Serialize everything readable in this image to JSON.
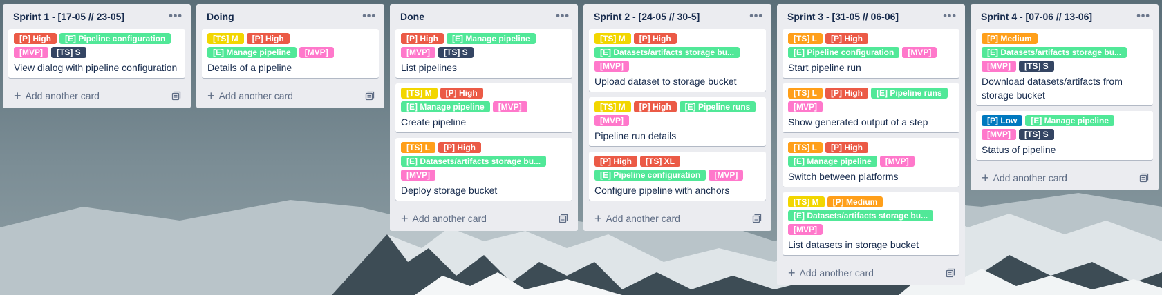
{
  "label_colors": {
    "green": "#61bd4f",
    "mint": "#51e898",
    "red": "#eb5a46",
    "orange": "#ff9f1a",
    "yellow": "#f2d600",
    "pink": "#ff78cb",
    "navy": "#344563",
    "blue": "#0079bf"
  },
  "add_card_label": "Add another card",
  "lists": [
    {
      "title": "Sprint 1 - [17-05 // 23-05]",
      "cards": [
        {
          "labels": [
            {
              "text": "[P] High",
              "color": "red"
            },
            {
              "text": "[E] Pipeline configuration",
              "color": "mint"
            },
            {
              "text": "[MVP]",
              "color": "pink"
            },
            {
              "text": "[TS] S",
              "color": "navy"
            }
          ],
          "title": "View dialog with pipeline configuration"
        }
      ]
    },
    {
      "title": "Doing",
      "cards": [
        {
          "labels": [
            {
              "text": "[TS] M",
              "color": "yellow"
            },
            {
              "text": "[P] High",
              "color": "red"
            },
            {
              "text": "[E] Manage pipeline",
              "color": "mint"
            },
            {
              "text": "[MVP]",
              "color": "pink"
            }
          ],
          "title": "Details of a pipeline"
        }
      ]
    },
    {
      "title": "Done",
      "cards": [
        {
          "labels": [
            {
              "text": "[P] High",
              "color": "red"
            },
            {
              "text": "[E] Manage pipeline",
              "color": "mint"
            },
            {
              "text": "[MVP]",
              "color": "pink"
            },
            {
              "text": "[TS] S",
              "color": "navy"
            }
          ],
          "title": "List pipelines"
        },
        {
          "labels": [
            {
              "text": "[TS] M",
              "color": "yellow"
            },
            {
              "text": "[P] High",
              "color": "red"
            },
            {
              "text": "[E] Manage pipeline",
              "color": "mint"
            },
            {
              "text": "[MVP]",
              "color": "pink"
            }
          ],
          "title": "Create pipeline"
        },
        {
          "labels": [
            {
              "text": "[TS] L",
              "color": "orange"
            },
            {
              "text": "[P] High",
              "color": "red"
            },
            {
              "text": "[E] Datasets/artifacts storage bu...",
              "color": "mint"
            },
            {
              "text": "[MVP]",
              "color": "pink"
            }
          ],
          "title": "Deploy storage bucket"
        }
      ]
    },
    {
      "title": "Sprint 2 - [24-05 // 30-5]",
      "cards": [
        {
          "labels": [
            {
              "text": "[TS] M",
              "color": "yellow"
            },
            {
              "text": "[P] High",
              "color": "red"
            },
            {
              "text": "[E] Datasets/artifacts storage bu...",
              "color": "mint"
            },
            {
              "text": "[MVP]",
              "color": "pink"
            }
          ],
          "title": "Upload dataset to storage bucket"
        },
        {
          "labels": [
            {
              "text": "[TS] M",
              "color": "yellow"
            },
            {
              "text": "[P] High",
              "color": "red"
            },
            {
              "text": "[E] Pipeline runs",
              "color": "mint"
            },
            {
              "text": "[MVP]",
              "color": "pink"
            }
          ],
          "title": "Pipeline run details"
        },
        {
          "labels": [
            {
              "text": "[P] High",
              "color": "red"
            },
            {
              "text": "[TS] XL",
              "color": "red"
            },
            {
              "text": "[E] Pipeline configuration",
              "color": "mint"
            },
            {
              "text": "[MVP]",
              "color": "pink"
            }
          ],
          "title": "Configure pipeline with anchors"
        }
      ]
    },
    {
      "title": "Sprint 3 - [31-05 // 06-06]",
      "cards": [
        {
          "labels": [
            {
              "text": "[TS] L",
              "color": "orange"
            },
            {
              "text": "[P] High",
              "color": "red"
            },
            {
              "text": "[E] Pipeline configuration",
              "color": "mint"
            },
            {
              "text": "[MVP]",
              "color": "pink"
            }
          ],
          "title": "Start pipeline run"
        },
        {
          "labels": [
            {
              "text": "[TS] L",
              "color": "orange"
            },
            {
              "text": "[P] High",
              "color": "red"
            },
            {
              "text": "[E] Pipeline runs",
              "color": "mint"
            },
            {
              "text": "[MVP]",
              "color": "pink"
            }
          ],
          "title": "Show generated output of a step"
        },
        {
          "labels": [
            {
              "text": "[TS] L",
              "color": "orange"
            },
            {
              "text": "[P] High",
              "color": "red"
            },
            {
              "text": "[E] Manage pipeline",
              "color": "mint"
            },
            {
              "text": "[MVP]",
              "color": "pink"
            }
          ],
          "title": "Switch between platforms"
        },
        {
          "labels": [
            {
              "text": "[TS] M",
              "color": "yellow"
            },
            {
              "text": "[P] Medium",
              "color": "orange"
            },
            {
              "text": "[E] Datasets/artifacts storage bu...",
              "color": "mint"
            },
            {
              "text": "[MVP]",
              "color": "pink"
            }
          ],
          "title": "List datasets in storage bucket"
        }
      ]
    },
    {
      "title": "Sprint 4 - [07-06 // 13-06]",
      "cards": [
        {
          "labels": [
            {
              "text": "[P] Medium",
              "color": "orange"
            },
            {
              "text": "[E] Datasets/artifacts storage bu...",
              "color": "mint"
            },
            {
              "text": "[MVP]",
              "color": "pink"
            },
            {
              "text": "[TS] S",
              "color": "navy"
            }
          ],
          "title": "Download datasets/artifacts from storage bucket"
        },
        {
          "labels": [
            {
              "text": "[P] Low",
              "color": "blue"
            },
            {
              "text": "[E] Manage pipeline",
              "color": "mint"
            },
            {
              "text": "[MVP]",
              "color": "pink"
            },
            {
              "text": "[TS] S",
              "color": "navy"
            }
          ],
          "title": "Status of pipeline"
        }
      ]
    }
  ]
}
